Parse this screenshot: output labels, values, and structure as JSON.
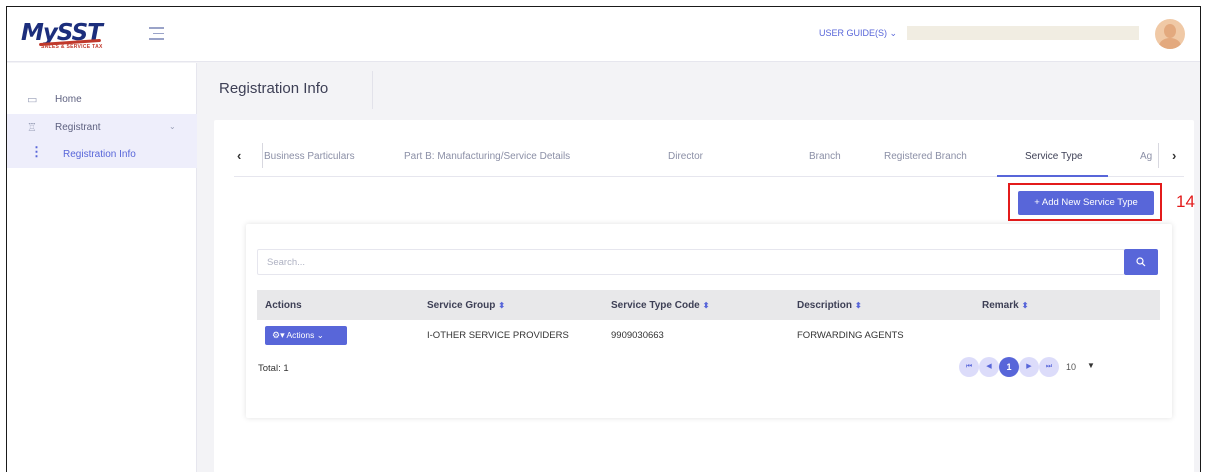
{
  "app": {
    "logo_text_my": "My",
    "logo_text_sst": "SST",
    "logo_tagline": "SALES & SERVICE TAX"
  },
  "header": {
    "user_guide": "USER GUIDE(S) ⌄"
  },
  "sidebar": {
    "items": [
      {
        "label": "Home",
        "icon": "home-icon"
      },
      {
        "label": "Registrant",
        "icon": "award-icon"
      }
    ],
    "subitems": [
      {
        "label": "Registration Info",
        "icon": "vertical-dots-icon"
      }
    ]
  },
  "page": {
    "title": "Registration Info"
  },
  "tabs": [
    {
      "label": "Business Particulars"
    },
    {
      "label": "Part B: Manufacturing/Service Details"
    },
    {
      "label": "Director"
    },
    {
      "label": "Branch"
    },
    {
      "label": "Registered Branch"
    },
    {
      "label": "Service Type",
      "active": true
    },
    {
      "label": "Ag"
    }
  ],
  "toolbar": {
    "add_label": "+ Add New Service Type",
    "annotation": "14"
  },
  "search": {
    "placeholder": "Search..."
  },
  "table": {
    "columns": [
      "Actions",
      "Service Group",
      "Service Type Code",
      "Description",
      "Remark"
    ],
    "rows": [
      {
        "action_label": "Actions",
        "service_group": "I-OTHER SERVICE PROVIDERS",
        "service_type_code": "9909030663",
        "description": "FORWARDING AGENTS",
        "remark": ""
      }
    ]
  },
  "footer": {
    "total": "Total: 1",
    "current_page": "1",
    "page_size": "10"
  },
  "colors": {
    "accent": "#5866d9",
    "annotation": "#e31b1b"
  }
}
